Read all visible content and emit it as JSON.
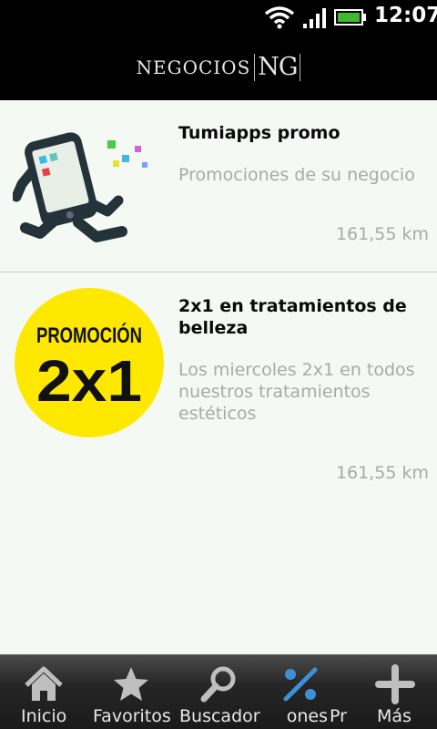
{
  "status_bar": {
    "time": "12:07",
    "icons": [
      "wifi-icon",
      "signal-icon",
      "battery-icon"
    ],
    "battery_color": "#3dbb2f"
  },
  "header": {
    "brand_text": "NEGOCIOS",
    "brand_mono": "NG"
  },
  "items": [
    {
      "title": "Tumiapps promo",
      "description": "Promociones de su negocio",
      "distance": "161,55 km",
      "thumbnail_icon": "running-phone-mascot"
    },
    {
      "title": "2x1 en tratamientos de belleza",
      "description": "Los miercoles 2x1 en todos nuestros tratamientos estéticos",
      "distance": "161,55 km",
      "thumbnail": {
        "line1": "PROMOCIÓN",
        "line2": "2x1",
        "background": "#ffe800"
      }
    }
  ],
  "tabs": [
    {
      "label": "Inicio",
      "icon": "home-icon"
    },
    {
      "label": "Favoritos",
      "icon": "star-icon"
    },
    {
      "label": "Buscador",
      "icon": "search-icon"
    },
    {
      "label": "ones",
      "icon": "percent-icon",
      "active": true,
      "active_color": "#3d8fd6"
    },
    {
      "label": "Pr",
      "icon": "none"
    },
    {
      "label": "Más",
      "icon": "plus-icon"
    }
  ]
}
